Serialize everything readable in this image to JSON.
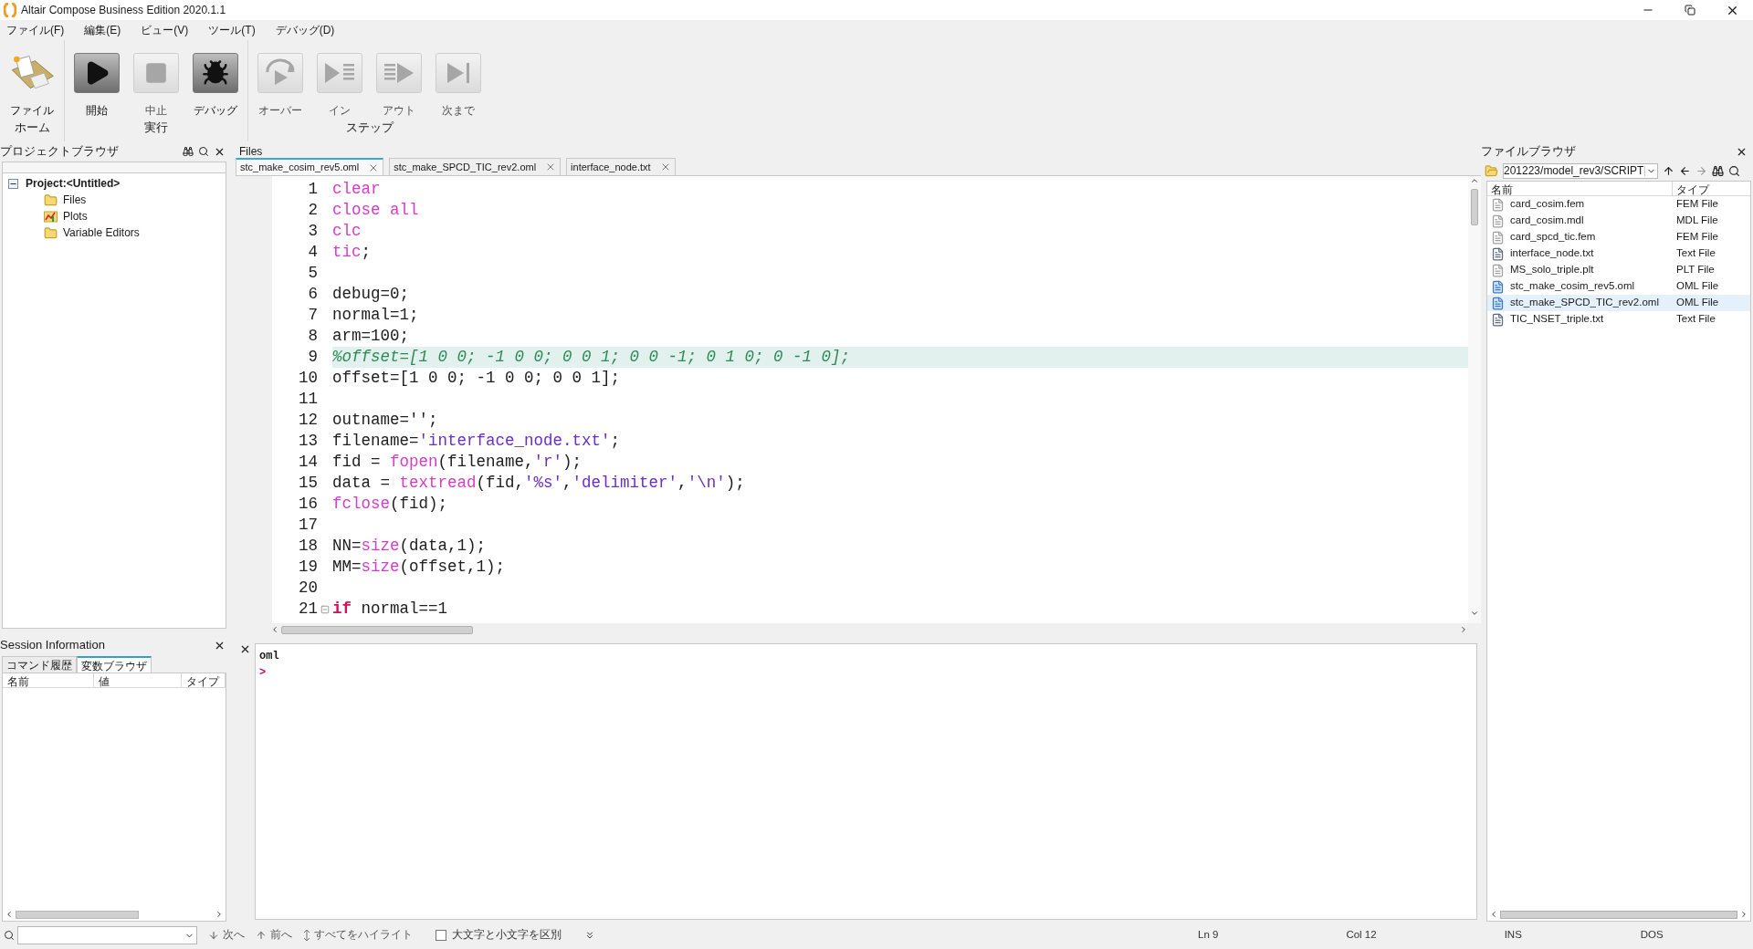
{
  "window": {
    "title": "Altair Compose Business Edition 2020.1.1"
  },
  "menu": [
    "ファイル(F)",
    "編集(E)",
    "ビュー(V)",
    "ツール(T)",
    "デバッグ(D)"
  ],
  "ribbon": {
    "groups": [
      {
        "label": "ホーム",
        "buttons": [
          {
            "label": "ファイル",
            "kind": "file",
            "disabled": false
          }
        ]
      },
      {
        "label": "実行",
        "buttons": [
          {
            "label": "開始",
            "kind": "play",
            "disabled": false
          },
          {
            "label": "中止",
            "kind": "stop",
            "disabled": true
          },
          {
            "label": "デバッグ",
            "kind": "debug",
            "disabled": false
          }
        ]
      },
      {
        "label": "ステップ",
        "buttons": [
          {
            "label": "オーバー",
            "kind": "over",
            "disabled": true
          },
          {
            "label": "イン",
            "kind": "in",
            "disabled": true
          },
          {
            "label": "アウト",
            "kind": "out",
            "disabled": true
          },
          {
            "label": "次まで",
            "kind": "next",
            "disabled": true
          }
        ]
      }
    ]
  },
  "project_browser": {
    "title": "プロジェクトブラウザ",
    "tree": [
      {
        "label": "Project:<Untitled>",
        "expanded": true,
        "children": [
          {
            "label": "Files",
            "kind": "folder"
          },
          {
            "label": "Plots",
            "kind": "plots"
          },
          {
            "label": "Variable Editors",
            "kind": "folder"
          }
        ]
      }
    ]
  },
  "editor": {
    "title": "Files",
    "tabs": [
      {
        "label": "stc_make_cosim_rev5.oml",
        "selected": true
      },
      {
        "label": "stc_make_SPCD_TIC_rev2.oml",
        "selected": false
      },
      {
        "label": "interface_node.txt",
        "selected": false
      }
    ],
    "lines": [
      {
        "number": "1",
        "selected": false,
        "fold": false,
        "tokens": [
          {
            "kind": "builtin",
            "text": "clear"
          }
        ]
      },
      {
        "number": "2",
        "selected": false,
        "fold": false,
        "tokens": [
          {
            "kind": "builtin",
            "text": "close all"
          }
        ]
      },
      {
        "number": "3",
        "selected": false,
        "fold": false,
        "tokens": [
          {
            "kind": "builtin",
            "text": "clc"
          }
        ]
      },
      {
        "number": "4",
        "selected": false,
        "fold": false,
        "tokens": [
          {
            "kind": "builtin",
            "text": "tic"
          },
          {
            "kind": "plain",
            "text": ";"
          }
        ]
      },
      {
        "number": "5",
        "selected": false,
        "fold": false
      },
      {
        "number": "6",
        "selected": false,
        "fold": false,
        "tokens": [
          {
            "kind": "plain",
            "text": "debug=0;"
          }
        ]
      },
      {
        "number": "7",
        "selected": false,
        "fold": false,
        "tokens": [
          {
            "kind": "plain",
            "text": "normal=1;"
          }
        ]
      },
      {
        "number": "8",
        "selected": false,
        "fold": false,
        "tokens": [
          {
            "kind": "plain",
            "text": "arm=100;"
          }
        ]
      },
      {
        "number": "9",
        "selected": true,
        "fold": false,
        "tokens": [
          {
            "kind": "comment",
            "text": "%offset=[1 0 0; -1 0 0; 0 0 1; 0 0 -1; 0 1 0; 0 -1 0];"
          }
        ]
      },
      {
        "number": "10",
        "selected": false,
        "fold": false,
        "tokens": [
          {
            "kind": "plain",
            "text": "offset=[1 0 0; -1 0 0; 0 0 1];"
          }
        ]
      },
      {
        "number": "11",
        "selected": false,
        "fold": false
      },
      {
        "number": "12",
        "selected": false,
        "fold": false,
        "tokens": [
          {
            "kind": "plain",
            "text": "outname='';"
          }
        ]
      },
      {
        "number": "13",
        "selected": false,
        "fold": false,
        "tokens": [
          {
            "kind": "plain",
            "text": "filename="
          },
          {
            "kind": "string",
            "text": "'interface_node.txt'"
          },
          {
            "kind": "plain",
            "text": ";"
          }
        ]
      },
      {
        "number": "14",
        "selected": false,
        "fold": false,
        "tokens": [
          {
            "kind": "plain",
            "text": "fid = "
          },
          {
            "kind": "builtin",
            "text": "fopen"
          },
          {
            "kind": "plain",
            "text": "(filename,"
          },
          {
            "kind": "string",
            "text": "'r'"
          },
          {
            "kind": "plain",
            "text": ");"
          }
        ]
      },
      {
        "number": "15",
        "selected": false,
        "fold": false,
        "tokens": [
          {
            "kind": "plain",
            "text": "data = "
          },
          {
            "kind": "builtin",
            "text": "textread"
          },
          {
            "kind": "plain",
            "text": "(fid,"
          },
          {
            "kind": "string",
            "text": "'%s'"
          },
          {
            "kind": "plain",
            "text": ","
          },
          {
            "kind": "string",
            "text": "'delimiter'"
          },
          {
            "kind": "plain",
            "text": ","
          },
          {
            "kind": "string",
            "text": "'\\n'"
          },
          {
            "kind": "plain",
            "text": ");"
          }
        ]
      },
      {
        "number": "16",
        "selected": false,
        "fold": false,
        "tokens": [
          {
            "kind": "builtin",
            "text": "fclose"
          },
          {
            "kind": "plain",
            "text": "(fid);"
          }
        ]
      },
      {
        "number": "17",
        "selected": false,
        "fold": false
      },
      {
        "number": "18",
        "selected": false,
        "fold": false,
        "tokens": [
          {
            "kind": "plain",
            "text": "NN="
          },
          {
            "kind": "builtin",
            "text": "size"
          },
          {
            "kind": "plain",
            "text": "(data,1);"
          }
        ]
      },
      {
        "number": "19",
        "selected": false,
        "fold": false,
        "tokens": [
          {
            "kind": "plain",
            "text": "MM="
          },
          {
            "kind": "builtin",
            "text": "size"
          },
          {
            "kind": "plain",
            "text": "(offset,1);"
          }
        ]
      },
      {
        "number": "20",
        "selected": false,
        "fold": false
      },
      {
        "number": "21",
        "selected": false,
        "fold": true,
        "tokens": [
          {
            "kind": "keyword",
            "text": "if"
          },
          {
            "kind": "plain",
            "text": " normal==1"
          }
        ]
      }
    ]
  },
  "console": {
    "lines": [
      "oml"
    ],
    "prompt": ">"
  },
  "session_info": {
    "title": "Session Information",
    "tabs": [
      {
        "label": "コマンド履歴",
        "selected": false
      },
      {
        "label": "変数ブラウザ",
        "selected": true
      }
    ],
    "columns": [
      "名前",
      "値",
      "タイプ"
    ]
  },
  "file_browser": {
    "title": "ファイルブラウザ",
    "path": "201223/model_rev3/SCRIPT",
    "columns": [
      "名前",
      "タイプ"
    ],
    "rows": [
      {
        "name": "card_cosim.fem",
        "type": "FEM File",
        "kind": "generic",
        "selected": false
      },
      {
        "name": "card_cosim.mdl",
        "type": "MDL File",
        "kind": "generic",
        "selected": false
      },
      {
        "name": "card_spcd_tic.fem",
        "type": "FEM File",
        "kind": "generic",
        "selected": false
      },
      {
        "name": "interface_node.txt",
        "type": "Text File",
        "kind": "txt",
        "selected": false
      },
      {
        "name": "MS_solo_triple.plt",
        "type": "PLT File",
        "kind": "generic",
        "selected": false
      },
      {
        "name": "stc_make_cosim_rev5.oml",
        "type": "OML File",
        "kind": "oml",
        "selected": false
      },
      {
        "name": "stc_make_SPCD_TIC_rev2.oml",
        "type": "OML File",
        "kind": "oml",
        "selected": true
      },
      {
        "name": "TIC_NSET_triple.txt",
        "type": "Text File",
        "kind": "txt",
        "selected": false
      }
    ]
  },
  "status_bar": {
    "find_buttons": [
      "次へ",
      "前へ",
      "すべてをハイライト"
    ],
    "match_case": {
      "label": "大文字と小文字を区別",
      "checked": false
    },
    "line": "Ln 9",
    "col": "Col 12",
    "mode": "INS",
    "eol": "DOS"
  }
}
